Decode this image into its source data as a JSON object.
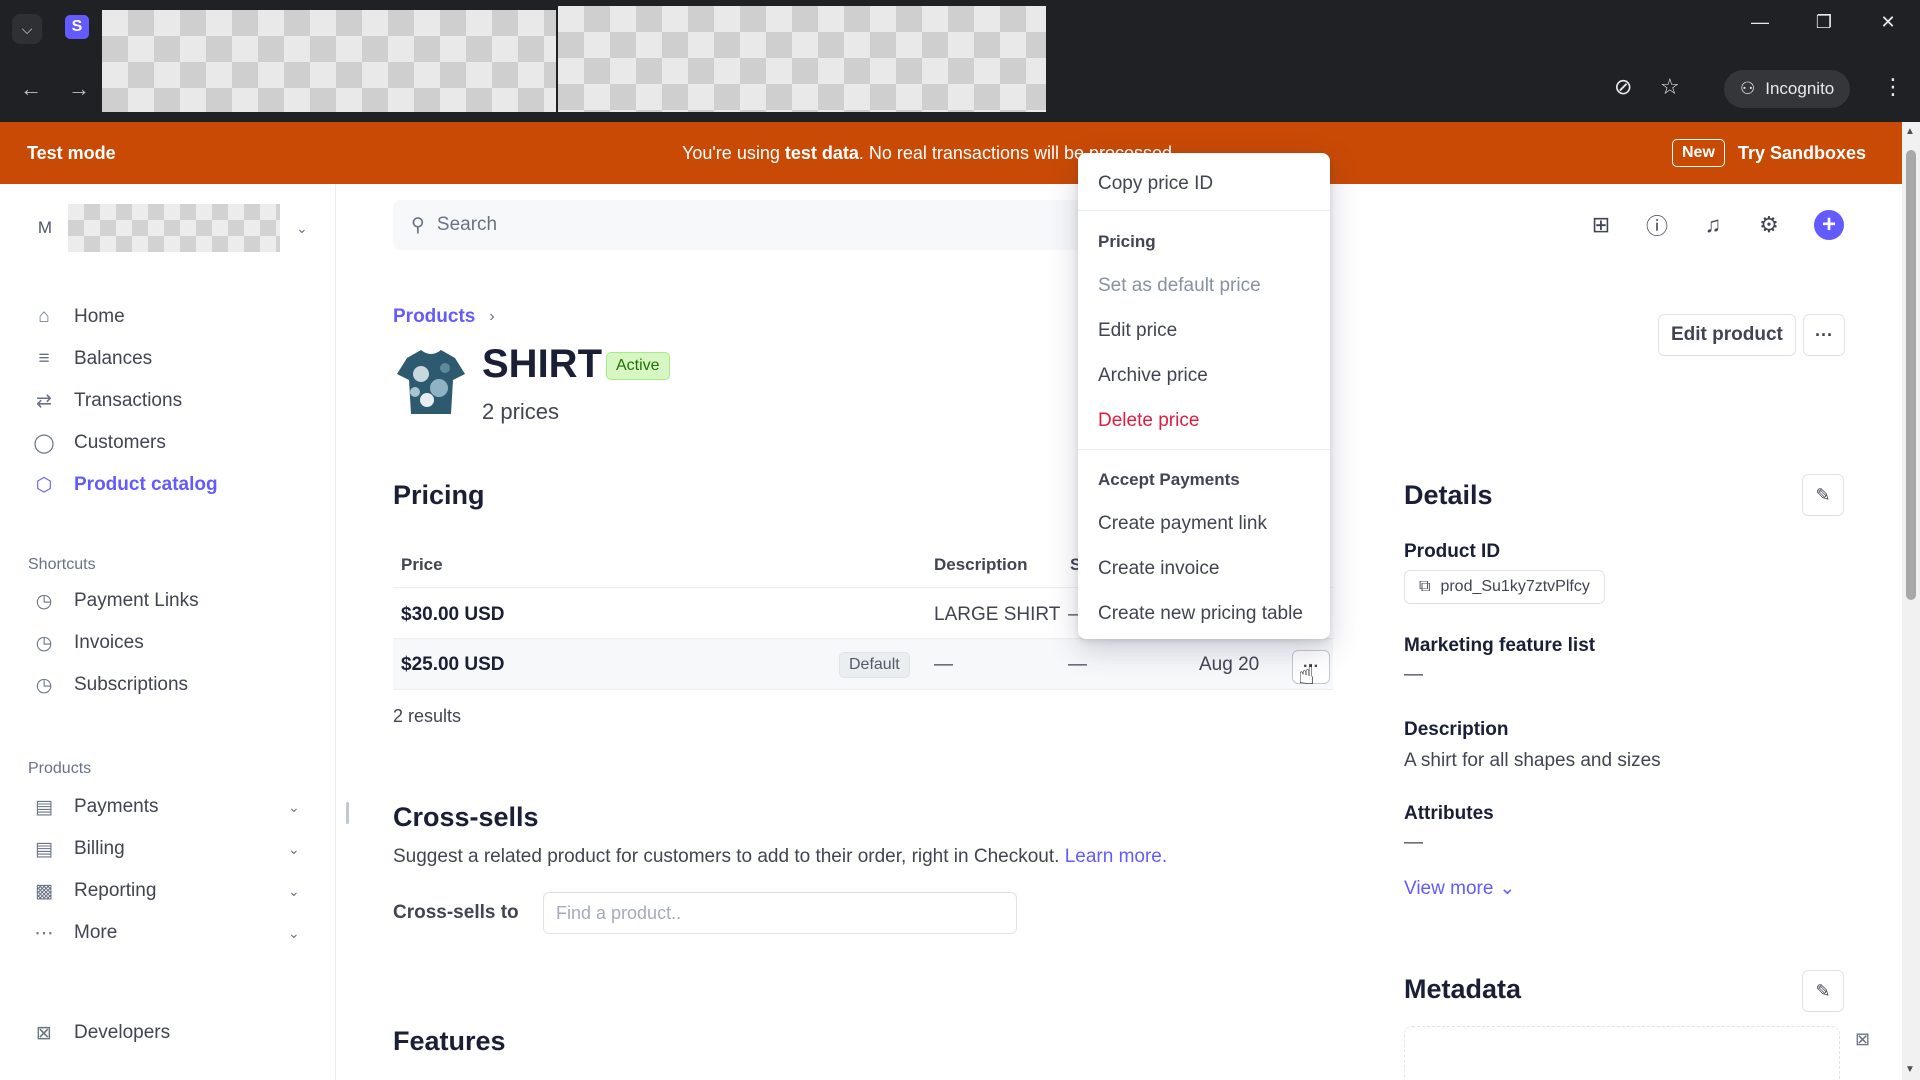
{
  "browser": {
    "incognito_label": "Incognito",
    "app_badge": "S"
  },
  "banner": {
    "test_mode": "Test mode",
    "message_prefix": "You're using ",
    "message_bold": "test data",
    "message_suffix": ". No real transactions will be processed.",
    "new_badge": "New",
    "try_sandboxes": "Try Sandboxes"
  },
  "sidebar": {
    "account_initial": "M",
    "nav": [
      {
        "label": "Home",
        "icon": "home-icon"
      },
      {
        "label": "Balances",
        "icon": "balances-icon"
      },
      {
        "label": "Transactions",
        "icon": "transactions-icon"
      },
      {
        "label": "Customers",
        "icon": "customers-icon"
      },
      {
        "label": "Product catalog",
        "icon": "product-catalog-icon"
      }
    ],
    "shortcuts_label": "Shortcuts",
    "shortcuts": [
      {
        "label": "Payment Links",
        "icon": "clock-icon"
      },
      {
        "label": "Invoices",
        "icon": "clock-icon"
      },
      {
        "label": "Subscriptions",
        "icon": "clock-icon"
      }
    ],
    "products_label": "Products",
    "products": [
      {
        "label": "Payments",
        "icon": "payments-icon"
      },
      {
        "label": "Billing",
        "icon": "billing-icon"
      },
      {
        "label": "Reporting",
        "icon": "reporting-icon"
      },
      {
        "label": "More",
        "icon": "more-dots-icon"
      }
    ],
    "developers": "Developers"
  },
  "search": {
    "placeholder": "Search"
  },
  "breadcrumb": {
    "products": "Products"
  },
  "product": {
    "name": "SHIRT",
    "status": "Active",
    "prices_count": "2 prices",
    "edit_button": "Edit product",
    "more_button": "···"
  },
  "pricing": {
    "title": "Pricing",
    "columns": {
      "price": "Price",
      "description": "Description",
      "s_col": "S"
    },
    "rows": [
      {
        "price": "$30.00 USD",
        "description": "LARGE SHIRT",
        "s": "—"
      },
      {
        "price": "$25.00 USD",
        "badge": "Default",
        "description": "—",
        "s": "—",
        "created": "Aug 20"
      }
    ],
    "results": "2 results",
    "row_more": "···"
  },
  "cross_sells": {
    "title": "Cross-sells",
    "description": "Suggest a related product for customers to add to their order, right in Checkout. ",
    "learn_more": "Learn more.",
    "label": "Cross-sells to",
    "placeholder": "Find a product.."
  },
  "features": {
    "title": "Features"
  },
  "details": {
    "title": "Details",
    "product_id_label": "Product ID",
    "product_id": "prod_Su1ky7ztvPlfcy",
    "marketing_label": "Marketing feature list",
    "marketing_value": "—",
    "description_label": "Description",
    "description_value": "A shirt for all shapes and sizes",
    "attributes_label": "Attributes",
    "attributes_value": "—",
    "view_more": "View more"
  },
  "metadata": {
    "title": "Metadata"
  },
  "menu": {
    "copy_price_id": "Copy price ID",
    "pricing_heading": "Pricing",
    "set_default": "Set as default price",
    "edit_price": "Edit price",
    "archive_price": "Archive price",
    "delete_price": "Delete price",
    "accept_heading": "Accept Payments",
    "create_payment_link": "Create payment link",
    "create_invoice": "Create invoice",
    "create_pricing_table": "Create new pricing table"
  },
  "colors": {
    "accent": "#635bff",
    "banner": "#c94a05",
    "danger": "#df1b41",
    "active_badge_bg": "#d7f7c2"
  }
}
